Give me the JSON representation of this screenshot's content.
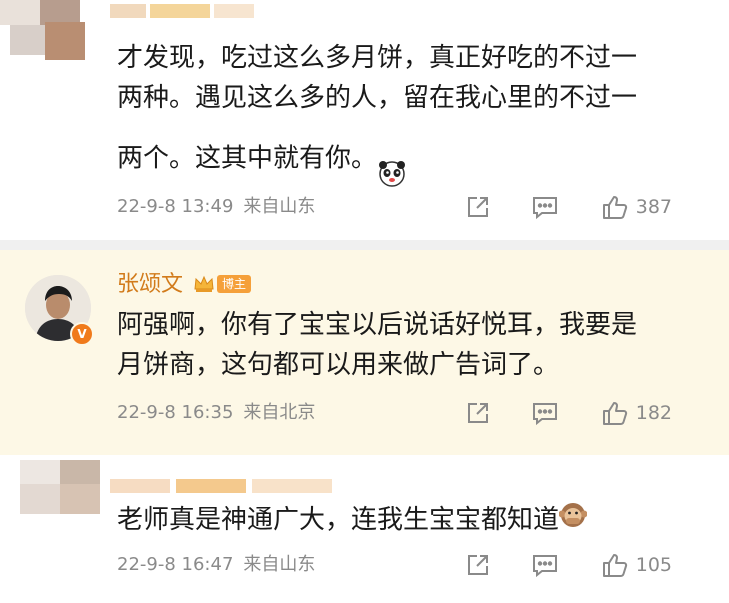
{
  "comments": [
    {
      "text": "才发现，吃过这么多月饼，真正好吃的不过一\n两种。遇见这么多的人，留在我心里的不过一\n两个。这其中就有你。",
      "emoji": "panda-face-icon",
      "date": "22-9-8 13:49",
      "location": "来自山东",
      "likes": "387"
    },
    {
      "username": "张颂文",
      "badge": "博主",
      "verified": "V",
      "text": "阿强啊，你有了宝宝以后说话好悦耳，我要是\n月饼商，这句都可以用来做广告词了。",
      "date": "22-9-8 16:35",
      "location": "来自北京",
      "likes": "182"
    },
    {
      "text": "老师真是神通广大，连我生宝宝都知道",
      "emoji": "speak-no-evil-monkey-icon",
      "date": "22-9-8 16:47",
      "location": "来自山东",
      "likes": "105"
    }
  ],
  "colors": {
    "highlight_bg": "#fdf8e6",
    "username": "#d27b1b",
    "meta": "#8a8a8a",
    "badge": "#f5a03a"
  }
}
